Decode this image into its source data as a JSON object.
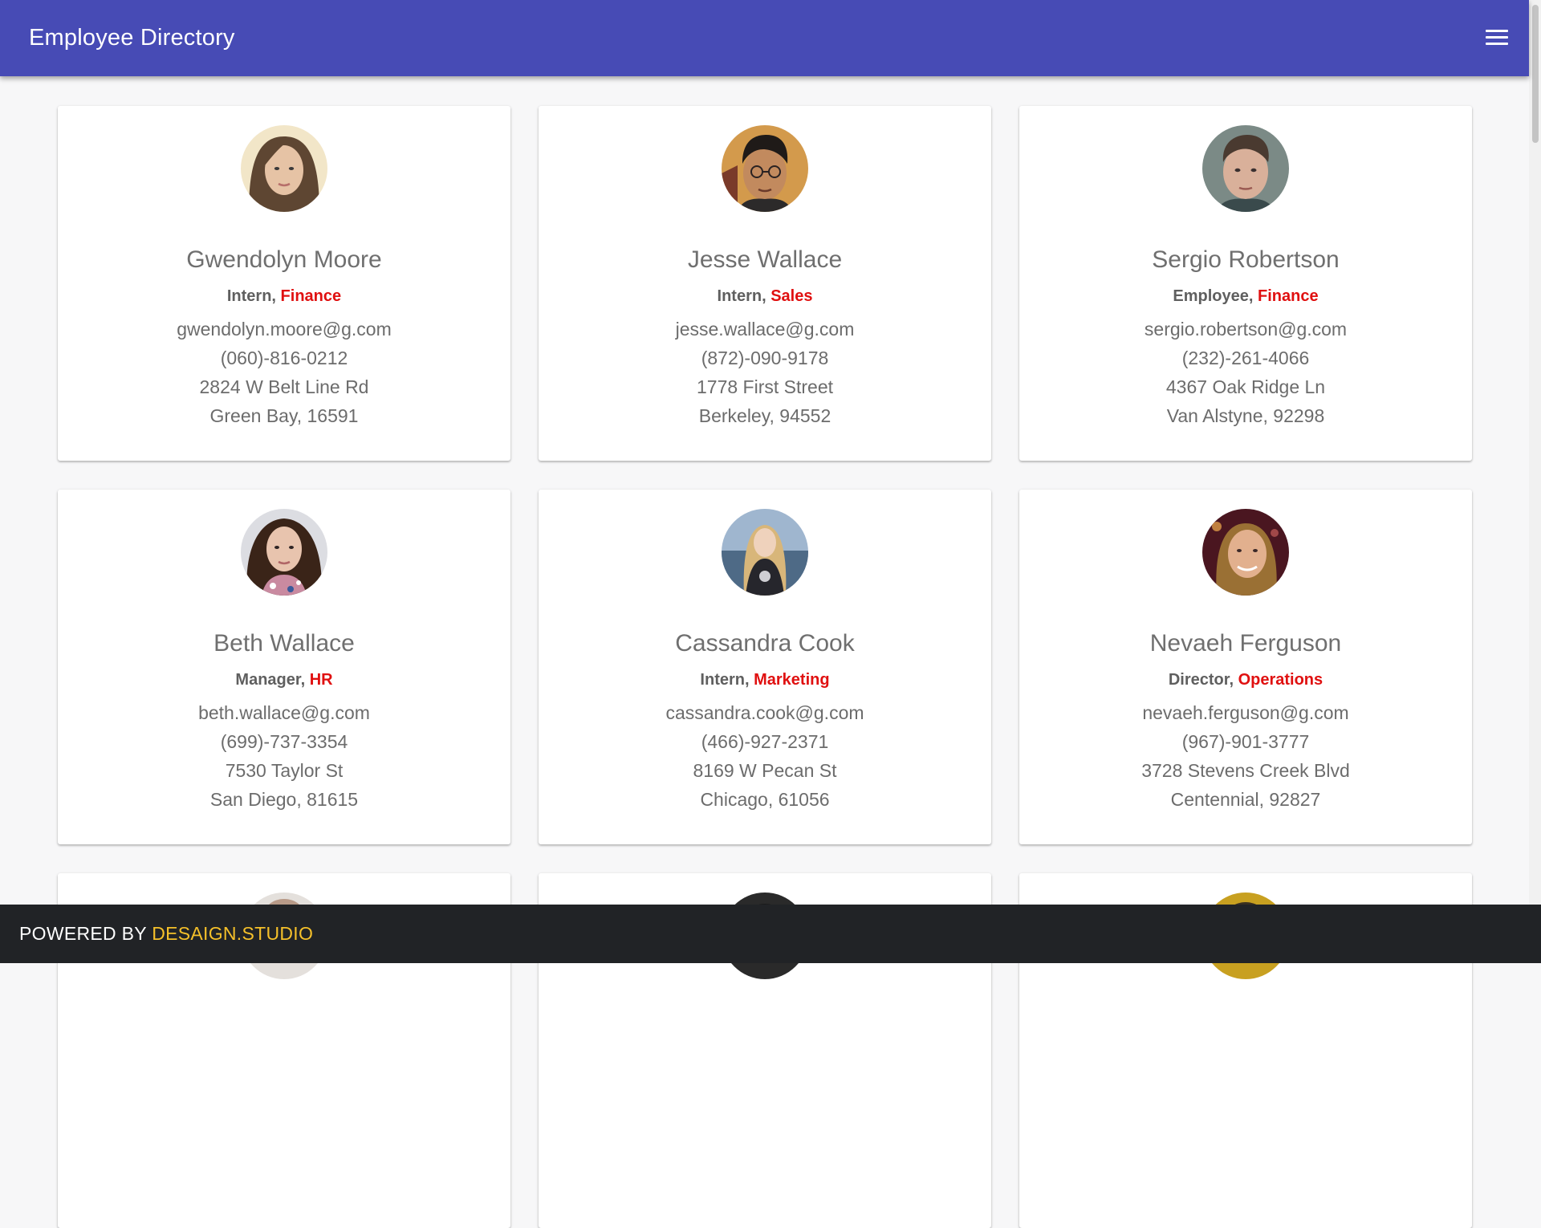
{
  "app": {
    "title": "Employee Directory"
  },
  "colors": {
    "appbar": "#474bb5",
    "department": "#e01010",
    "footer": "#212326",
    "footer_brand": "#f5c02a"
  },
  "icons": {
    "menu": "menu-icon"
  },
  "employees": [
    {
      "name": "Gwendolyn Moore",
      "role": "Intern",
      "department": "Finance",
      "email": "gwendolyn.moore@g.com",
      "phone": "(060)-816-0212",
      "street": "2824 W Belt Line Rd",
      "city": "Green Bay, 16591"
    },
    {
      "name": "Jesse Wallace",
      "role": "Intern",
      "department": "Sales",
      "email": "jesse.wallace@g.com",
      "phone": "(872)-090-9178",
      "street": "1778 First Street",
      "city": "Berkeley, 94552"
    },
    {
      "name": "Sergio Robertson",
      "role": "Employee",
      "department": "Finance",
      "email": "sergio.robertson@g.com",
      "phone": "(232)-261-4066",
      "street": "4367 Oak Ridge Ln",
      "city": "Van Alstyne, 92298"
    },
    {
      "name": "Beth Wallace",
      "role": "Manager",
      "department": "HR",
      "email": "beth.wallace@g.com",
      "phone": "(699)-737-3354",
      "street": "7530 Taylor St",
      "city": "San Diego, 81615"
    },
    {
      "name": "Cassandra Cook",
      "role": "Intern",
      "department": "Marketing",
      "email": "cassandra.cook@g.com",
      "phone": "(466)-927-2371",
      "street": "8169 W Pecan St",
      "city": "Chicago, 61056"
    },
    {
      "name": "Nevaeh Ferguson",
      "role": "Director",
      "department": "Operations",
      "email": "nevaeh.ferguson@g.com",
      "phone": "(967)-901-3777",
      "street": "3728 Stevens Creek Blvd",
      "city": "Centennial, 92827"
    }
  ],
  "footer": {
    "prefix": "POWERED BY ",
    "brand": "DESAIGN.STUDIO"
  }
}
